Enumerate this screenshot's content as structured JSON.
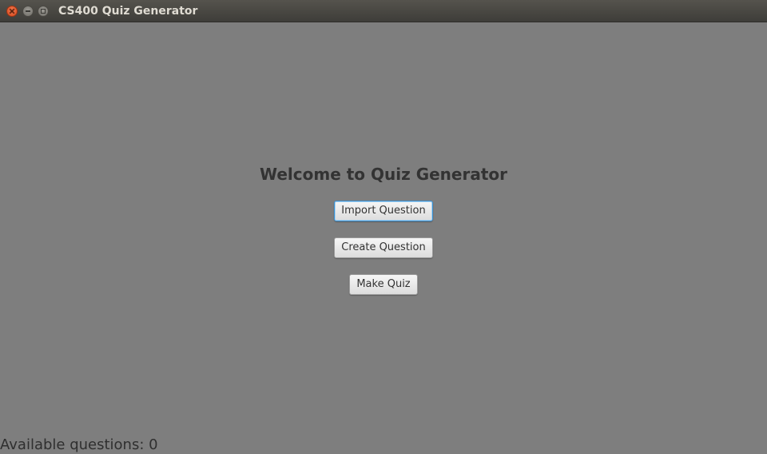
{
  "window": {
    "title": "CS400 Quiz Generator"
  },
  "main": {
    "heading": "Welcome to Quiz Generator",
    "buttons": {
      "import": "Import Question",
      "create": "Create Question",
      "make_quiz": "Make Quiz"
    }
  },
  "status": {
    "available_questions": "Available questions: 0"
  },
  "icons": {
    "close": "close-icon",
    "minimize": "minimize-icon",
    "maximize": "maximize-icon"
  },
  "colors": {
    "background": "#7e7e7e",
    "titlebar": "#3e3d39",
    "close_button": "#e25a2a",
    "focus_border": "#3c8fcf"
  }
}
